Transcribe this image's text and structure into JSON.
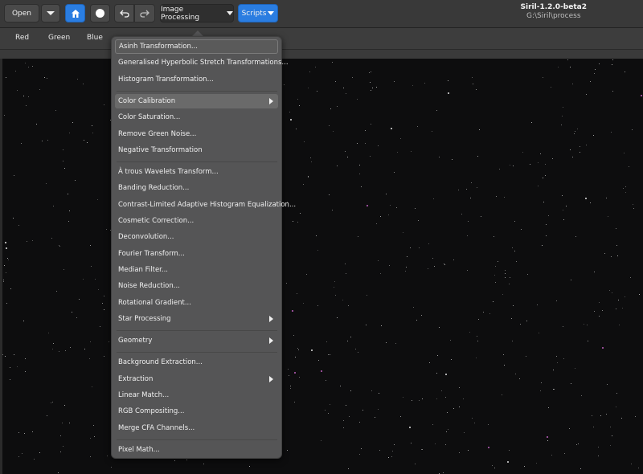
{
  "window": {
    "title": "Siril-1.2.0-beta2",
    "subtitle": "G:\\Siril\\process"
  },
  "toolbar": {
    "open_label": "Open",
    "open_menu_icon": "chevron-down-icon",
    "home_icon": "home-icon",
    "record_icon": "circle-icon",
    "undo_icon": "undo-icon",
    "redo_icon": "redo-icon",
    "image_processing_label": "Image Processing",
    "scripts_label": "Scripts",
    "accent_color": "#2a7de1"
  },
  "tabs": [
    {
      "label": "Red"
    },
    {
      "label": "Green"
    },
    {
      "label": "Blue"
    }
  ],
  "menu": {
    "items": [
      {
        "label": "Asinh Transformation...",
        "submenu": false,
        "state": "focused"
      },
      {
        "label": "Generalised Hyperbolic Stretch Transformations...",
        "submenu": false
      },
      {
        "label": "Histogram Transformation...",
        "submenu": false
      },
      {
        "separator": true
      },
      {
        "label": "Color Calibration",
        "submenu": true,
        "state": "hover"
      },
      {
        "label": "Color Saturation...",
        "submenu": false
      },
      {
        "label": "Remove Green Noise...",
        "submenu": false
      },
      {
        "label": "Negative Transformation",
        "submenu": false
      },
      {
        "separator": true
      },
      {
        "label": "À trous Wavelets Transform...",
        "submenu": false
      },
      {
        "label": "Banding Reduction...",
        "submenu": false
      },
      {
        "label": "Contrast-Limited Adaptive Histogram Equalization...",
        "submenu": false
      },
      {
        "label": "Cosmetic Correction...",
        "submenu": false
      },
      {
        "label": "Deconvolution...",
        "submenu": false
      },
      {
        "label": "Fourier Transform...",
        "submenu": false
      },
      {
        "label": "Median Filter...",
        "submenu": false
      },
      {
        "label": "Noise Reduction...",
        "submenu": false
      },
      {
        "label": "Rotational Gradient...",
        "submenu": false
      },
      {
        "label": "Star Processing",
        "submenu": true
      },
      {
        "separator": true
      },
      {
        "label": "Geometry",
        "submenu": true
      },
      {
        "separator": true
      },
      {
        "label": "Background Extraction...",
        "submenu": false
      },
      {
        "label": "Extraction",
        "submenu": true
      },
      {
        "label": "Linear Match...",
        "submenu": false
      },
      {
        "label": "RGB Compositing...",
        "submenu": false
      },
      {
        "label": "Merge CFA Channels...",
        "submenu": false
      },
      {
        "separator": true
      },
      {
        "label": "Pixel Math...",
        "submenu": false
      }
    ]
  }
}
